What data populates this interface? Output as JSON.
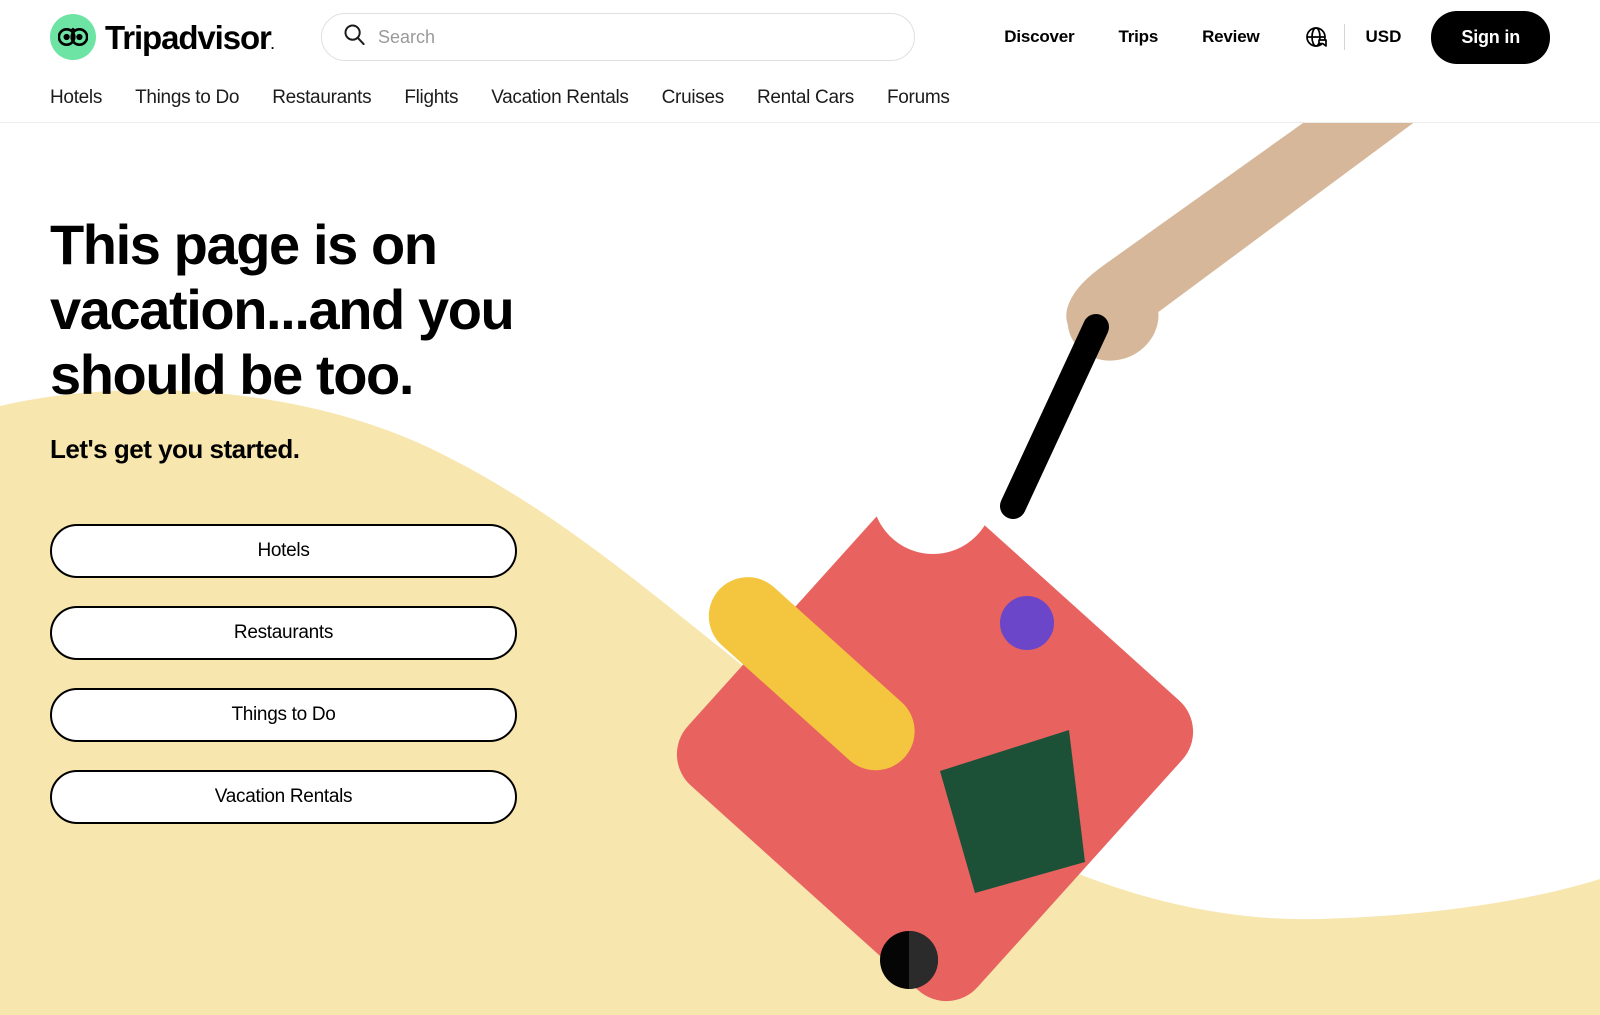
{
  "brand": {
    "name": "Tripadvisor",
    "trademark": ".",
    "logo_icon": "owl-logo-icon",
    "logo_circle_color": "#6ee4a4"
  },
  "search": {
    "placeholder": "Search",
    "value": "",
    "icon": "search-icon"
  },
  "header": {
    "links": [
      {
        "label": "Discover",
        "name": "discover"
      },
      {
        "label": "Trips",
        "name": "trips"
      },
      {
        "label": "Review",
        "name": "review"
      }
    ],
    "globe_icon": "globe-icon",
    "currency": "USD",
    "signin_label": "Sign in"
  },
  "primary_nav": {
    "items": [
      {
        "label": "Hotels"
      },
      {
        "label": "Things to Do"
      },
      {
        "label": "Restaurants"
      },
      {
        "label": "Flights"
      },
      {
        "label": "Vacation Rentals"
      },
      {
        "label": "Cruises"
      },
      {
        "label": "Rental Cars"
      },
      {
        "label": "Forums"
      }
    ]
  },
  "hero": {
    "headline": "This page is on vacation...and you should be too.",
    "subhead": "Let's get you started.",
    "cta_buttons": [
      {
        "label": "Hotels"
      },
      {
        "label": "Restaurants"
      },
      {
        "label": "Things to Do"
      },
      {
        "label": "Vacation Rentals"
      }
    ]
  },
  "illustration": {
    "name": "suitcase-on-vacation-illustration",
    "colors": {
      "sand_blob": "#f7e6ae",
      "suitcase_body": "#e8635f",
      "suitcase_stripe": "#f4c63f",
      "suitcase_badge_white": "#ffffff",
      "suitcase_badge_purple": "#6b46c8",
      "suitcase_patch_green": "#1c5138",
      "handle_black": "#000000",
      "arm_tan": "#d6b79a",
      "wheel_black": "#050505",
      "wheel_highlight": "#2b2b2b"
    }
  }
}
